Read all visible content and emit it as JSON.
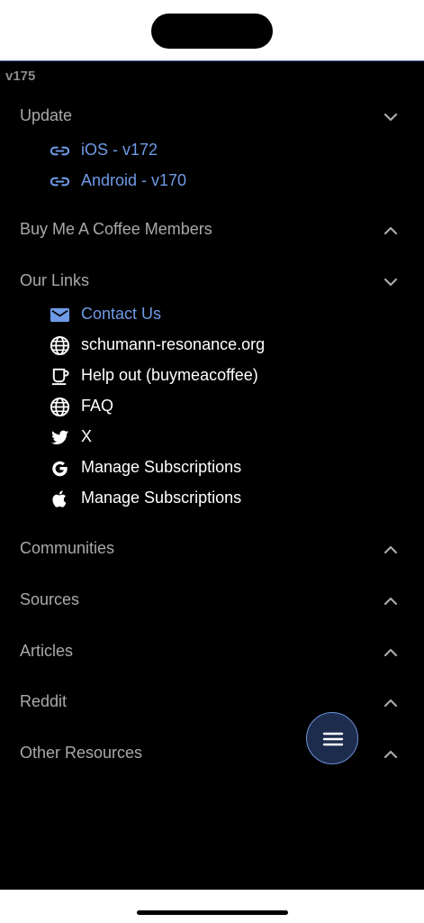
{
  "version": "v175",
  "sections": {
    "update": {
      "title": "Update",
      "items": [
        {
          "label": "iOS - v172",
          "icon": "link-icon"
        },
        {
          "label": "Android - v170",
          "icon": "link-icon"
        }
      ]
    },
    "members": {
      "title": "Buy Me A Coffee Members"
    },
    "links": {
      "title": "Our Links",
      "items": [
        {
          "label": "Contact Us",
          "icon": "mail-icon"
        },
        {
          "label": "schumann-resonance.org",
          "icon": "globe-icon"
        },
        {
          "label": "Help out (buymeacoffee)",
          "icon": "coffee-cup-icon"
        },
        {
          "label": "FAQ",
          "icon": "globe-icon"
        },
        {
          "label": "X",
          "icon": "twitter-bird-icon"
        },
        {
          "label": "Manage Subscriptions",
          "icon": "google-icon"
        },
        {
          "label": "Manage Subscriptions",
          "icon": "apple-icon"
        }
      ]
    },
    "communities": {
      "title": "Communities"
    },
    "sources": {
      "title": "Sources"
    },
    "articles": {
      "title": "Articles"
    },
    "reddit": {
      "title": "Reddit"
    },
    "other": {
      "title": "Other Resources"
    }
  },
  "colors": {
    "background": "#000000",
    "link": "#6e9ae6",
    "section_title": "#a9a9a9",
    "fab": "#1d2c4d"
  },
  "fab": {
    "icon": "menu-icon"
  }
}
